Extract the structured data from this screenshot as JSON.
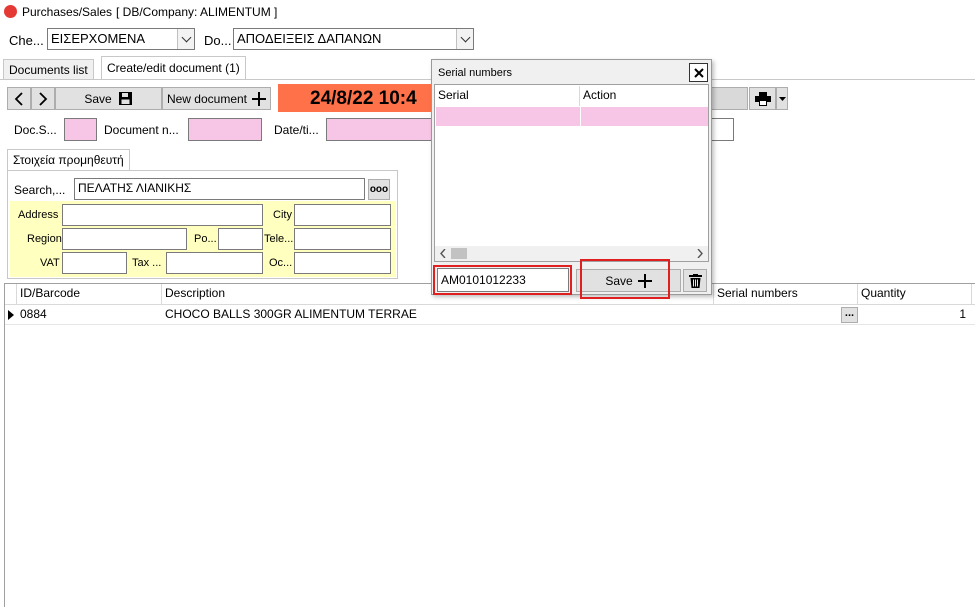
{
  "window": {
    "title": "Purchases/Sales",
    "db_company": "[ DB/Company: ALIMENTUM ]"
  },
  "filters": {
    "che_label": "Che...",
    "che_value": "ΕΙΣΕΡΧΟΜΕΝΑ",
    "do_label": "Do...",
    "do_value": "ΑΠΟΔΕΙΞΕΙΣ ΔΑΠΑΝΩΝ"
  },
  "tabs": [
    {
      "label": "Documents list"
    },
    {
      "label": "Create/edit document (1)"
    }
  ],
  "toolbar": {
    "save_label": "Save",
    "new_document_label": "New document",
    "datetime_banner": "24/8/22 10:4"
  },
  "doc_fields": {
    "doc_s_label": "Doc.S...",
    "document_n_label": "Document n...",
    "date_label": "Date/ti..."
  },
  "supplier": {
    "tab_label": "Στοιχεία προμηθευτή",
    "search_label": "Search,...",
    "search_value": "ΠΕΛΑΤΗΣ ΛΙΑΝΙΚΗΣ",
    "lookup_label": "ooo",
    "address_label": "Address",
    "city_label": "City",
    "region_label": "Region",
    "po_label": "Po...",
    "tele_label": "Tele...",
    "vat_label": "VAT",
    "tax_label": "Tax ...",
    "oc_label": "Oc..."
  },
  "grid": {
    "columns": [
      "ID/Barcode",
      "Description",
      "Serial numbers",
      "Quantity"
    ],
    "rows": [
      {
        "id": "0884",
        "description": "CHOCO BALLS 300GR ALIMENTUM TERRAE",
        "serial_button": "...",
        "quantity": "1"
      }
    ]
  },
  "serial_dialog": {
    "title": "Serial numbers",
    "columns": [
      "Serial",
      "Action"
    ],
    "serial_input": "AM0101012233",
    "save_label": "Save"
  },
  "colors": {
    "pink_field": "#f7c6e6",
    "datetime_banner": "#ff7148",
    "highlight_red": "#e02020",
    "supplier_panel": "#ffffc0"
  }
}
